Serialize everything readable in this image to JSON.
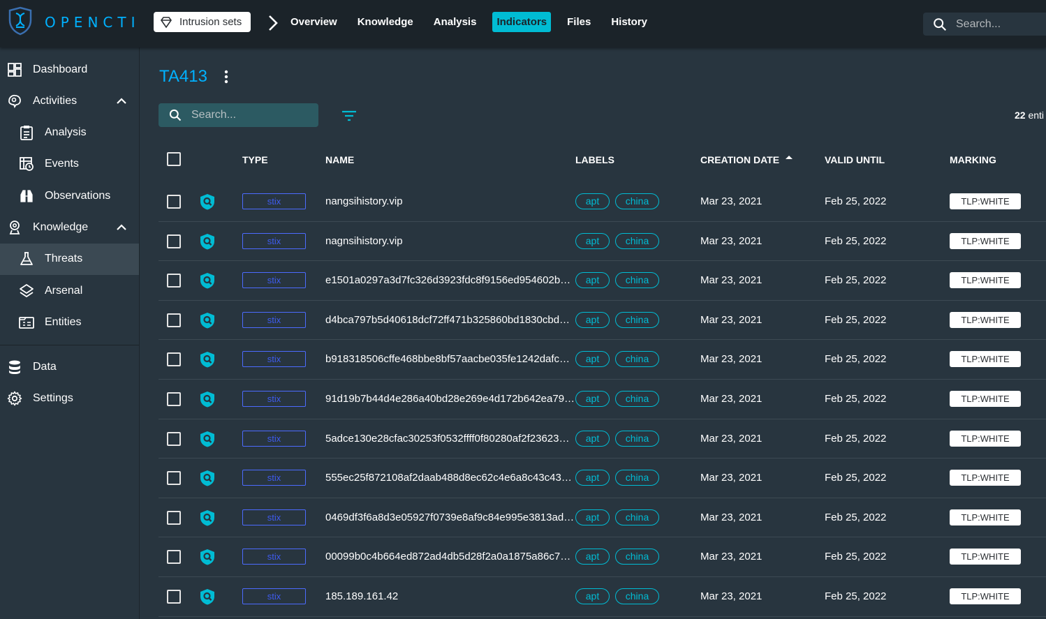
{
  "app": {
    "brand": "OPENCTI"
  },
  "header": {
    "entity_type": "Intrusion sets",
    "nav": [
      "Overview",
      "Knowledge",
      "Analysis",
      "Indicators",
      "Files",
      "History"
    ],
    "active_nav": "Indicators",
    "search_placeholder": "Search..."
  },
  "sidebar": {
    "items": [
      {
        "label": "Dashboard",
        "icon": "dashboard-icon"
      },
      {
        "label": "Activities",
        "icon": "activities-icon",
        "expanded": true
      },
      {
        "label": "Analysis",
        "icon": "analysis-icon",
        "sub": true
      },
      {
        "label": "Events",
        "icon": "events-icon",
        "sub": true
      },
      {
        "label": "Observations",
        "icon": "observations-icon",
        "sub": true
      },
      {
        "label": "Knowledge",
        "icon": "knowledge-icon",
        "expanded": true
      },
      {
        "label": "Threats",
        "icon": "threats-icon",
        "sub": true,
        "active": true
      },
      {
        "label": "Arsenal",
        "icon": "arsenal-icon",
        "sub": true
      },
      {
        "label": "Entities",
        "icon": "entities-icon",
        "sub": true
      },
      {
        "label": "Data",
        "icon": "data-icon"
      },
      {
        "label": "Settings",
        "icon": "settings-icon"
      }
    ]
  },
  "main": {
    "title": "TA413",
    "search_placeholder": "Search...",
    "count_value": "22",
    "count_suffix": "enti",
    "columns": {
      "type": "TYPE",
      "name": "NAME",
      "labels": "LABELS",
      "creation_date": "CREATION DATE",
      "valid_until": "VALID UNTIL",
      "marking": "MARKING"
    },
    "rows": [
      {
        "type": "stix",
        "name": "nangsihistory.vip",
        "labels": [
          "apt",
          "china"
        ],
        "created": "Mar 23, 2021",
        "valid_until": "Feb 25, 2022",
        "marking": "TLP:WHITE"
      },
      {
        "type": "stix",
        "name": "nagnsihistory.vip",
        "labels": [
          "apt",
          "china"
        ],
        "created": "Mar 23, 2021",
        "valid_until": "Feb 25, 2022",
        "marking": "TLP:WHITE"
      },
      {
        "type": "stix",
        "name": "e1501a0297a3d7fc326d3923fdc8f9156ed954602b…",
        "labels": [
          "apt",
          "china"
        ],
        "created": "Mar 23, 2021",
        "valid_until": "Feb 25, 2022",
        "marking": "TLP:WHITE"
      },
      {
        "type": "stix",
        "name": "d4bca797b5d40618dcf72ff471b325860bd1830cbd…",
        "labels": [
          "apt",
          "china"
        ],
        "created": "Mar 23, 2021",
        "valid_until": "Feb 25, 2022",
        "marking": "TLP:WHITE"
      },
      {
        "type": "stix",
        "name": "b918318506cffe468bbe8bf57aacbe035fe1242dafc…",
        "labels": [
          "apt",
          "china"
        ],
        "created": "Mar 23, 2021",
        "valid_until": "Feb 25, 2022",
        "marking": "TLP:WHITE"
      },
      {
        "type": "stix",
        "name": "91d19b7b44d4e286a40bd28e269e4d172b642ea79…",
        "labels": [
          "apt",
          "china"
        ],
        "created": "Mar 23, 2021",
        "valid_until": "Feb 25, 2022",
        "marking": "TLP:WHITE"
      },
      {
        "type": "stix",
        "name": "5adce130e28cfac30253f0532ffff0f80280af2f23623…",
        "labels": [
          "apt",
          "china"
        ],
        "created": "Mar 23, 2021",
        "valid_until": "Feb 25, 2022",
        "marking": "TLP:WHITE"
      },
      {
        "type": "stix",
        "name": "555ec25f872108af2daab488d8ec62c4e6a8c43c43…",
        "labels": [
          "apt",
          "china"
        ],
        "created": "Mar 23, 2021",
        "valid_until": "Feb 25, 2022",
        "marking": "TLP:WHITE"
      },
      {
        "type": "stix",
        "name": "0469df3f6a8d3e05927f0739e8af9c84e995e3813ad…",
        "labels": [
          "apt",
          "china"
        ],
        "created": "Mar 23, 2021",
        "valid_until": "Feb 25, 2022",
        "marking": "TLP:WHITE"
      },
      {
        "type": "stix",
        "name": "00099b0c4b664ed872ad4db5d28f2a0a1875a86c75…",
        "labels": [
          "apt",
          "china"
        ],
        "created": "Mar 23, 2021",
        "valid_until": "Feb 25, 2022",
        "marking": "TLP:WHITE"
      },
      {
        "type": "stix",
        "name": "185.189.161.42",
        "labels": [
          "apt",
          "china"
        ],
        "created": "Mar 23, 2021",
        "valid_until": "Feb 25, 2022",
        "marking": "TLP:WHITE"
      }
    ]
  },
  "colors": {
    "accent": "#00b1ff",
    "active_tab": "#00bcd4",
    "topbar_bg": "#1b2329",
    "page_bg": "#28353f",
    "stix_chip": "#4c6bff"
  }
}
